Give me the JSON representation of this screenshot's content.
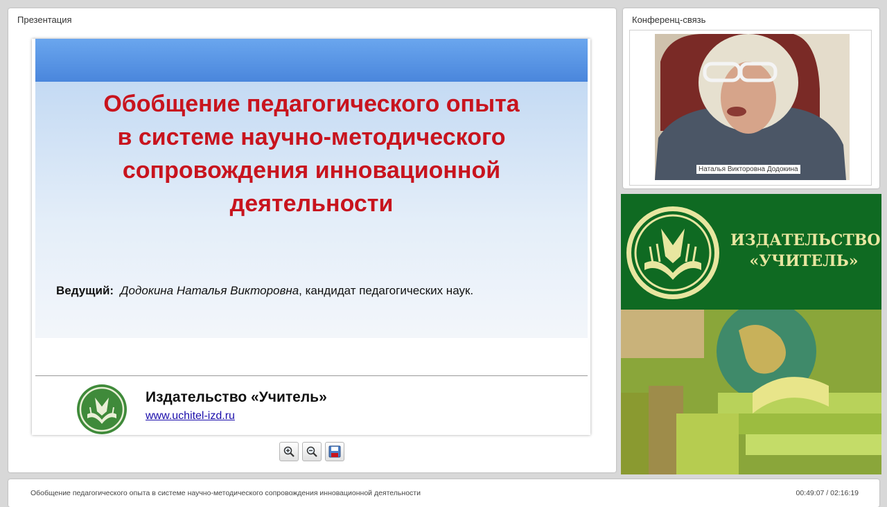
{
  "presentation": {
    "panel_title": "Презентация",
    "slide": {
      "title": "Обобщение педагогического опыта\nв системе научно-методического\nсопровождения инновационной\nдеятельности",
      "presenter_label": "Ведущий:",
      "presenter_name": "Додокина Наталья Викторовна",
      "presenter_rest": ", кандидат педагогических наук.",
      "publisher": "Издательство «Учитель»",
      "url": "www.uchitel-izd.ru"
    },
    "tools": [
      "zoom-in-icon",
      "zoom-out-icon",
      "save-icon"
    ]
  },
  "conference": {
    "panel_title": "Конференц-связь",
    "speaker_name": "Наталья Викторовна Додокина"
  },
  "banner": {
    "text": "ИЗДАТЕЛЬСТВО\n«УЧИТЕЛЬ»"
  },
  "footer": {
    "title": "Обобщение педагогического опыта в системе научно-методического сопровождения инновационной деятельности",
    "time": "00:49:07 / 02:16:19"
  },
  "colors": {
    "slide_title": "#c8141e",
    "brand_green": "#0f6a22",
    "link": "#1a0dab"
  }
}
